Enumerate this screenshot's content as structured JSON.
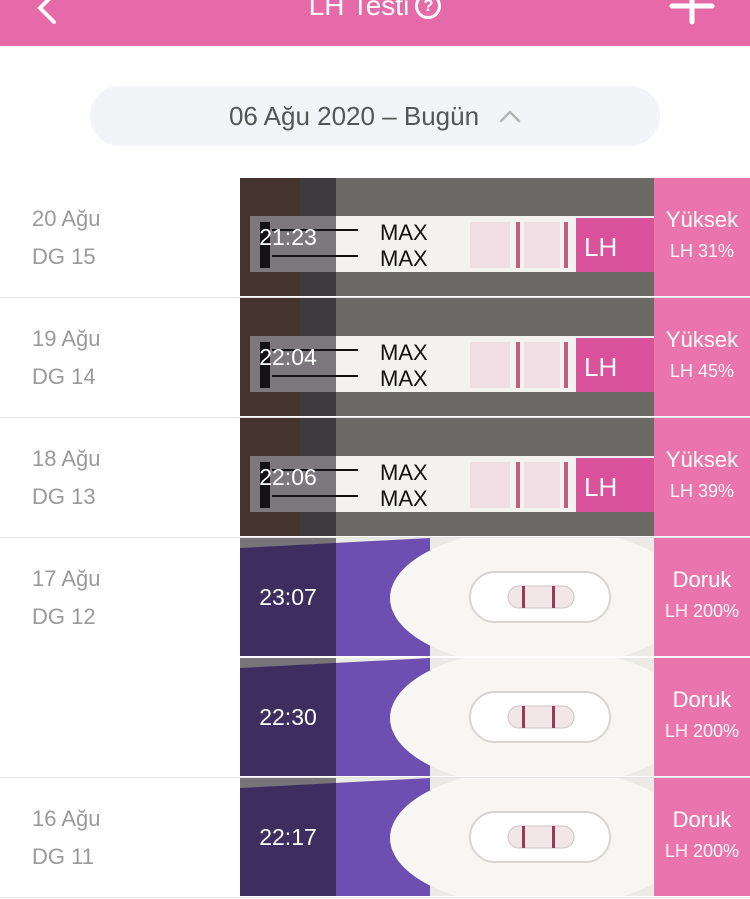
{
  "header": {
    "title": "LH Testi",
    "help_icon": "question-circle-icon",
    "back_icon": "chevron-left-icon",
    "add_icon": "plus-icon",
    "bg_color": "#e66aa8"
  },
  "filter": {
    "range": "06 Ağu 2020 – Bugün",
    "toggle_icon": "chevron-up-icon"
  },
  "days": [
    {
      "date": "20 Ağu",
      "cycle_day": "DG 15",
      "tests": [
        {
          "time": "21:23",
          "level": "Yüksek",
          "lh": "LH 31%",
          "kind": "strip"
        }
      ]
    },
    {
      "date": "19 Ağu",
      "cycle_day": "DG 14",
      "tests": [
        {
          "time": "22:04",
          "level": "Yüksek",
          "lh": "LH 45%",
          "kind": "strip"
        }
      ]
    },
    {
      "date": "18 Ağu",
      "cycle_day": "DG 13",
      "tests": [
        {
          "time": "22:06",
          "level": "Yüksek",
          "lh": "LH 39%",
          "kind": "strip"
        }
      ]
    },
    {
      "date": "17 Ağu",
      "cycle_day": "DG 12",
      "tests": [
        {
          "time": "23:07",
          "level": "Doruk",
          "lh": "LH 200%",
          "kind": "midstream"
        },
        {
          "time": "22:30",
          "level": "Doruk",
          "lh": "LH 200%",
          "kind": "midstream"
        }
      ]
    },
    {
      "date": "16 Ağu",
      "cycle_day": "DG 11",
      "tests": [
        {
          "time": "22:17",
          "level": "Doruk",
          "lh": "LH 200%",
          "kind": "midstream"
        }
      ]
    }
  ],
  "strip_text": "MAX",
  "strip_logo": "LH"
}
